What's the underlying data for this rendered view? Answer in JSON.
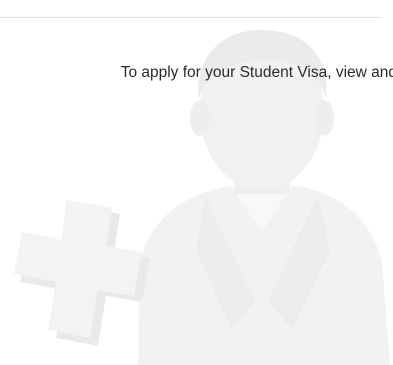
{
  "intro": {
    "text": "To apply for your Student Visa, view and"
  },
  "illustration": {
    "icon": "add-user-icon",
    "fill_color": "#f3f3f3",
    "shadow_color": "#e9e9e9"
  },
  "colors": {
    "background": "#ffffff",
    "divider": "#e1e1e1",
    "text": "#2b2b2b"
  }
}
